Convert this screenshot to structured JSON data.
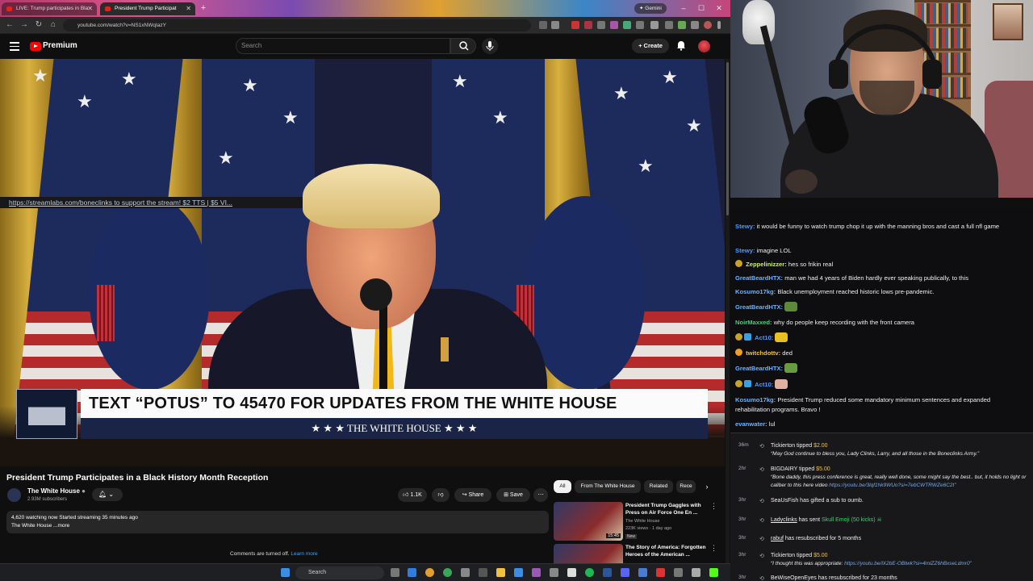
{
  "browser": {
    "tabs": [
      {
        "title": "LIVE: Trump participates in Bla"
      },
      {
        "title": "President Trump Participat"
      }
    ],
    "gemini_label": "Gemini",
    "url": "youtube.com/watch?v=NS1xNWqIazY"
  },
  "youtube": {
    "brand": "Premium",
    "search_placeholder": "Search",
    "create_label": "Create",
    "video": {
      "banner_main": "TEXT “POTUS” TO 45470 FOR UPDATES FROM THE WHITE HOUSE",
      "banner_sub": "★ ★ ★  THE WHITE HOUSE  ★ ★ ★"
    },
    "title": "President Trump Participates in a Black History Month Reception",
    "channel": {
      "name": "The White House",
      "subs": "2.93M subscribers"
    },
    "actions": {
      "likes": "1.1K",
      "share": "Share",
      "save": "Save"
    },
    "description": {
      "line1": "4,620 watching now  Started streaming 35 minutes ago",
      "line2": "The White House ...more"
    },
    "comments_off": "Comments are turned off.",
    "learn_more": "Learn more",
    "chips": [
      "All",
      "From The White House",
      "Related",
      "Rece"
    ],
    "recommended": [
      {
        "title": "President Trump Gaggles with Press on Air Force One En ...",
        "channel": "The White House",
        "meta": "223K views · 1 day ago",
        "badge": "New",
        "duration": "15:45"
      },
      {
        "title": "The Story of America: Forgotten Heroes of the American ...",
        "channel": "",
        "meta": "",
        "badge": "",
        "duration": ""
      }
    ]
  },
  "taskbar": {
    "search_label": "Search"
  },
  "stream": {
    "tip_line": "https://streamlabs.com/boneclinks to support the stream! $2 TTS | $5 VI..."
  },
  "chat": [
    {
      "user": "Stewy:",
      "color": "#4d9bff",
      "text": " it would be funny to watch trump chop it up with the manning bros and cast a full nfl game"
    },
    {
      "user": "Stewy:",
      "color": "#4d9bff",
      "text": " imagine LOL"
    },
    {
      "user": "Zeppelinizzer:",
      "color": "#c7f068",
      "text": " hes so frikin real"
    },
    {
      "user": "GreatBeardHTX:",
      "color": "#6ab4ff",
      "text": " man we had 4 years of Biden hardly ever speaking publically, to this"
    },
    {
      "user": "Kosumo17kg:",
      "color": "#6ab4ff",
      "text": " Black unemployment reached historic lows pre-pandemic."
    },
    {
      "user": "GreatBeardHTX:",
      "color": "#6ab4ff",
      "text": ""
    },
    {
      "user": "NoirMaxxed:",
      "color": "#3dd27a",
      "text": " why do people keep recording with the front camera"
    },
    {
      "user": "Act10:",
      "color": "#4d9bff",
      "text": ""
    },
    {
      "user": "twitchdottv:",
      "color": "#f0c040",
      "text": " ded"
    },
    {
      "user": "GreatBeardHTX:",
      "color": "#6ab4ff",
      "text": ""
    },
    {
      "user": "Act10:",
      "color": "#4d9bff",
      "text": ""
    },
    {
      "user": "Kosumo17kg:",
      "color": "#6ab4ff",
      "text": " President Trump reduced some mandatory minimum sentences and expanded rehabilitation programs. Bravo !"
    },
    {
      "user": "evanwater:",
      "color": "#6ab4ff",
      "text": " lul"
    }
  ],
  "events": [
    {
      "time": "36m",
      "user": "Tickierton",
      "action": " tipped ",
      "amount": "$2.00",
      "quote": "“May God continue to bless you, Lady Clinks, Larry, and all those in the Boneclinks Army.”",
      "link": ""
    },
    {
      "time": "2hr",
      "user": "BIGDAIRY",
      "action": " tipped ",
      "amount": "$5.00",
      "quote": "“Bone daddy, this press conference is great, really well done, some might say the best.. but, it holds no light or caliber to this here video ",
      "link": "https://youtu.be/3lqf1hk9WUo?si=7ebCWTRWZe6C2t”"
    },
    {
      "time": "3hr",
      "user": "SeaUsFish",
      "action": " has gifted a sub to ",
      "amount": "oumb.",
      "quote": "",
      "link": ""
    },
    {
      "time": "3hr",
      "user": "Ladyclinks",
      "action": " has sent ",
      "amount": "Skull Emoji (50 kicks)",
      "quote": "",
      "link": ""
    },
    {
      "time": "3hr",
      "user": "rabuf",
      "action": " has resubscribed for 5 months",
      "amount": "",
      "quote": "",
      "link": ""
    },
    {
      "time": "3hr",
      "user": "Tickierton",
      "action": " tipped ",
      "amount": "$5.00",
      "quote": "“I thought this was appropriate: ",
      "link": "https://youtu.be/lX2bE-OBtwk?si=4mlZZ6hBxseLdmr0”"
    },
    {
      "time": "3hr",
      "user": "BeWiseOpenEyes",
      "action": " has resubscribed for 23 months",
      "amount": "",
      "quote": "",
      "link": ""
    }
  ]
}
